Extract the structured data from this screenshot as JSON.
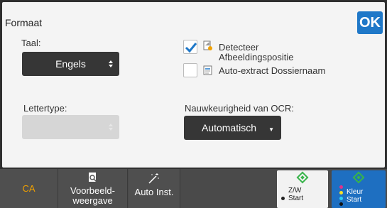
{
  "header": {
    "title": "Formaat",
    "ok_label": "OK"
  },
  "language": {
    "label": "Taal:",
    "value": "Engels"
  },
  "options": [
    {
      "label": "Detecteer Afbeeldingspositie",
      "line1": "Detecteer",
      "line2": "Afbeeldingspositie",
      "checked": true
    },
    {
      "label": "Auto-extract Dossiernaam",
      "checked": false
    }
  ],
  "font": {
    "label": "Lettertype:",
    "value": ""
  },
  "ocr": {
    "label": "Nauwkeurigheid van OCR:",
    "value": "Automatisch"
  },
  "bottombar": {
    "ca_label": "CA",
    "preview_line1": "Voorbeeld-",
    "preview_line2": "weergave",
    "auto_label": "Auto Inst.",
    "bw_line1": "Z/W",
    "bw_line2": "Start",
    "color_line1": "Kleur",
    "color_line2": "Start"
  },
  "colors": {
    "accent": "#1f78c8",
    "ca": "#f0a000",
    "start_green": "#38b44a"
  }
}
